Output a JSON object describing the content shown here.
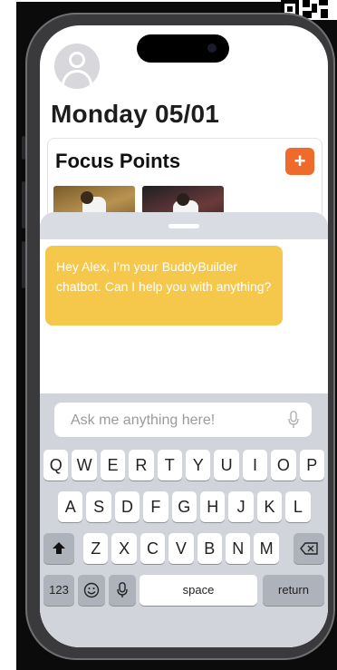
{
  "header": {
    "date": "Monday 05/01"
  },
  "focus_card": {
    "title": "Focus Points",
    "add_label": "+"
  },
  "chat": {
    "message": "Hey Alex, I’m your BuddyBuilder chatbot. Can I help you with anything?"
  },
  "input": {
    "placeholder": "Ask me anything here!"
  },
  "keyboard": {
    "row1": [
      "Q",
      "W",
      "E",
      "R",
      "T",
      "Y",
      "U",
      "I",
      "O",
      "P"
    ],
    "row2": [
      "A",
      "S",
      "D",
      "F",
      "G",
      "H",
      "J",
      "K",
      "L"
    ],
    "row3": [
      "Z",
      "X",
      "C",
      "V",
      "B",
      "N",
      "M"
    ],
    "numbers_label": "123",
    "space_label": "space",
    "return_label": "return"
  },
  "colors": {
    "accent_orange": "#ee6b2b",
    "bubble_yellow": "#f5c84c",
    "keyboard_bg": "#d1d4da"
  },
  "icons": [
    "user-avatar-icon",
    "plus-icon",
    "microphone-icon",
    "shift-icon",
    "backspace-icon",
    "emoji-icon",
    "dictation-icon"
  ]
}
